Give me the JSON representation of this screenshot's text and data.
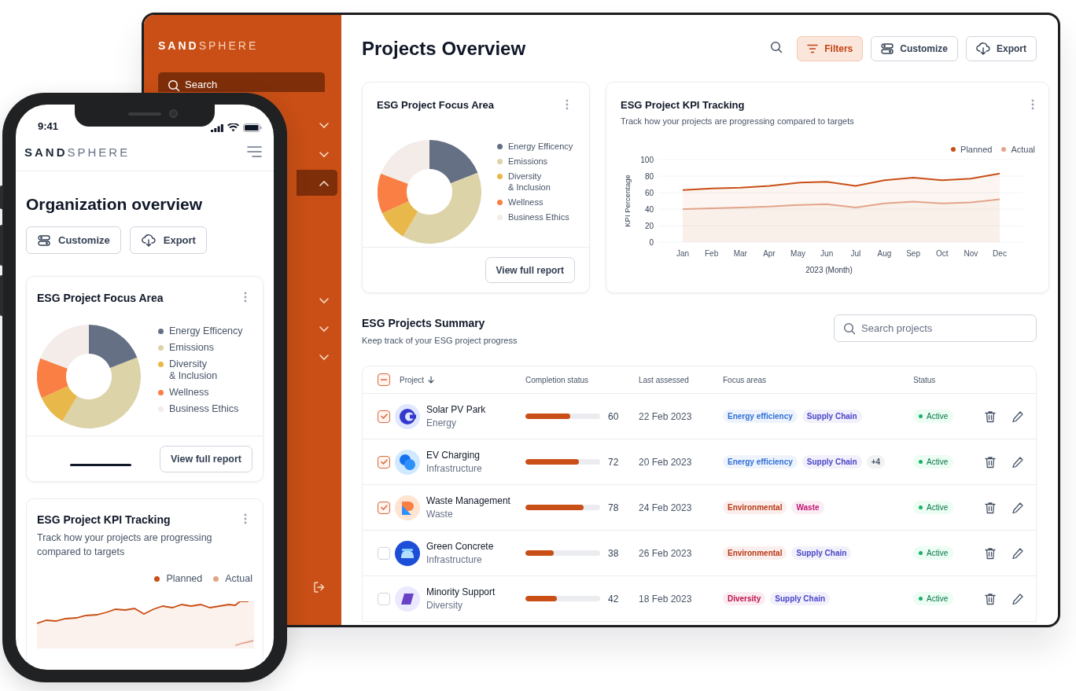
{
  "desktop": {
    "sidebar": {
      "logo": {
        "strong": "SAND",
        "light": "SPHERE"
      },
      "search": {
        "placeholder": "Search"
      },
      "nav_items": [
        {
          "expanded": false,
          "selected": false
        },
        {
          "expanded": false,
          "selected": false
        },
        {
          "expanded": true,
          "selected": true
        },
        {
          "expanded": false,
          "selected": false
        },
        {
          "expanded": false,
          "selected": false
        },
        {
          "expanded": false,
          "selected": false
        }
      ]
    },
    "header": {
      "title": "Projects Overview",
      "buttons": [
        {
          "label": "Filters",
          "selected": true
        },
        {
          "label": "Customize",
          "selected": false
        },
        {
          "label": "Export",
          "selected": false
        }
      ]
    },
    "focus_card": {
      "title": "ESG Project Focus Area",
      "legend": [
        {
          "label": "Energy Efficency",
          "color": "#667085"
        },
        {
          "label": "Emissions",
          "color": "#ddd3a9"
        },
        {
          "label": "Diversity\n& Inclusion",
          "color": "#e8b84a"
        },
        {
          "label": "Wellness",
          "color": "#f97f45"
        },
        {
          "label": "Business Ethics",
          "color": "#f3ece9"
        }
      ],
      "button": "View full report"
    },
    "kpi_card": {
      "title": "ESG Project KPI Tracking",
      "subtitle": "Track how your projects are progressing compared to targets",
      "chart_data": {
        "type": "area",
        "grid": true,
        "xlabel": "2023 (Month)",
        "ylabel": "KPI Percentage",
        "categories": [
          "Jan",
          "Feb",
          "Mar",
          "Apr",
          "May",
          "Jun",
          "Jul",
          "Aug",
          "Sep",
          "Oct",
          "Nov",
          "Dec"
        ],
        "ylim": [
          0,
          100
        ],
        "yticks": [
          0,
          20,
          40,
          60,
          80,
          100
        ],
        "series": [
          {
            "name": "Planned",
            "color": "#c94f16",
            "values": [
              63,
              65,
              66,
              68,
              72,
              73,
              68,
              75,
              78,
              75,
              77,
              83
            ]
          },
          {
            "name": "Actual",
            "color": "#e3a48a",
            "values": [
              40,
              41,
              42,
              43,
              45,
              46,
              42,
              47,
              49,
              47,
              48,
              52
            ]
          }
        ]
      }
    },
    "summary": {
      "title": "ESG Projects Summary",
      "subtitle": "Keep track of your ESG project progress",
      "search": {
        "placeholder": "Search projects"
      },
      "table": {
        "select_all": {
          "indeterminate": true
        },
        "columns": [
          "Project",
          "Completion status",
          "Last assessed",
          "Focus areas",
          "Status"
        ],
        "rows": [
          {
            "checked": true,
            "name": "Solar PV Park",
            "category": "Energy",
            "level": 0.6,
            "reading": "60",
            "date": "22 Feb 2023",
            "tags": [
              {
                "label": "Energy efficiency",
                "color": "#2e6fd8"
              },
              {
                "label": "Supply Chain",
                "color": "#4a45c8"
              }
            ],
            "status": "Active"
          },
          {
            "checked": true,
            "name": "EV Charging",
            "category": "Infrastructure",
            "level": 0.72,
            "reading": "72",
            "date": "20 Feb 2023",
            "tags": [
              {
                "label": "Energy efficiency",
                "color": "#2e6fd8"
              },
              {
                "label": "Supply Chain",
                "color": "#4a45c8"
              },
              {
                "label": "+4",
                "color": "#475467"
              }
            ],
            "status": "Active"
          },
          {
            "checked": true,
            "name": "Waste Management",
            "category": "Waste",
            "level": 0.78,
            "reading": "78",
            "date": "24 Feb 2023",
            "tags": [
              {
                "label": "Environmental",
                "color": "#b93815"
              },
              {
                "label": "Waste",
                "color": "#c11574"
              }
            ],
            "status": "Active"
          },
          {
            "checked": false,
            "name": "Green Concrete",
            "category": "Infrastructure",
            "level": 0.38,
            "reading": "38",
            "date": "26 Feb 2023",
            "tags": [
              {
                "label": "Environmental",
                "color": "#b93815"
              },
              {
                "label": "Supply Chain",
                "color": "#4a45c8"
              }
            ],
            "status": "Active"
          },
          {
            "checked": false,
            "name": "Minority Support",
            "category": "Diversity",
            "level": 0.42,
            "reading": "42",
            "date": "18 Feb 2023",
            "tags": [
              {
                "label": "Diversity",
                "color": "#c01048"
              },
              {
                "label": "Supply Chain",
                "color": "#4a45c8"
              }
            ],
            "status": "Active"
          }
        ]
      }
    }
  },
  "phone": {
    "time": "9:41",
    "logo": {
      "strong": "SAND",
      "light": "SPHERE"
    },
    "title": "Organization overview",
    "buttons": [
      {
        "label": "Customize"
      },
      {
        "label": "Export"
      }
    ],
    "focus_card": {
      "title": "ESG Project Focus Area",
      "legend": [
        {
          "label": "Energy Efficency",
          "color": "#667085"
        },
        {
          "label": "Emissions",
          "color": "#ddd3a9"
        },
        {
          "label": "Diversity\n& Inclusion",
          "color": "#e8b84a"
        },
        {
          "label": "Wellness",
          "color": "#f97f45"
        },
        {
          "label": "Business Ethics",
          "color": "#f3ece9"
        }
      ],
      "button": "View full report"
    },
    "kpi_card": {
      "title": "ESG Project KPI Tracking",
      "subtitle": "Track how your projects are progressing compared to targets",
      "legend": [
        {
          "label": "Planned",
          "color": "#c94f16"
        },
        {
          "label": "Actual",
          "color": "#e3a48a"
        }
      ]
    }
  }
}
